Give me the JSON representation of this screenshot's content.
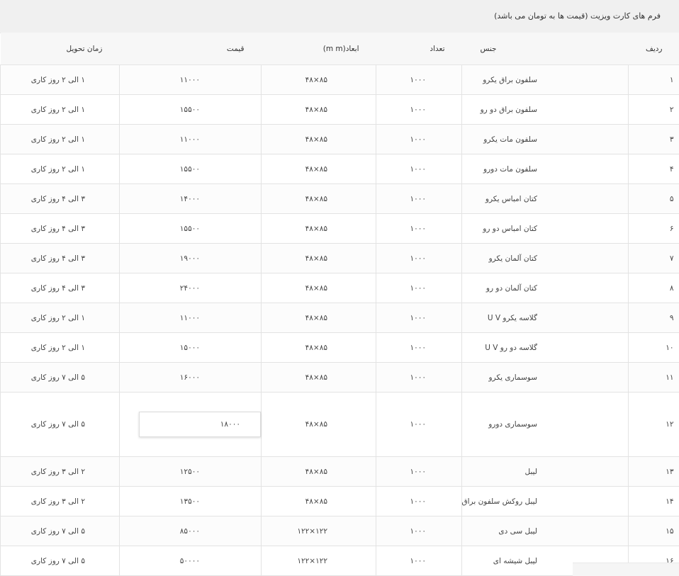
{
  "caption": "فرم های کارت ویزیت (قیمت ها به تومان می باشد)",
  "headers": {
    "row": "ردیف",
    "material": "جنس",
    "quantity": "تعداد",
    "dimensions": "ابعاد(m m)",
    "price": "قیمت",
    "delivery": "زمان تحویل"
  },
  "rows": [
    {
      "num": "۱",
      "material": "سلفون براق یکرو",
      "qty": "۱۰۰۰",
      "dim": "۸۵×۴۸",
      "price": "۱۱۰۰۰",
      "time": "۱ الی ۲ روز کاری"
    },
    {
      "num": "۲",
      "material": "سلفون براق دو رو",
      "qty": "۱۰۰۰",
      "dim": "۸۵×۴۸",
      "price": "۱۵۵۰۰",
      "time": "۱ الی ۲ روز کاری"
    },
    {
      "num": "۳",
      "material": "سلفون مات یکرو",
      "qty": "۱۰۰۰",
      "dim": "۸۵×۴۸",
      "price": "۱۱۰۰۰",
      "time": "۱ الی ۲ روز کاری"
    },
    {
      "num": "۴",
      "material": "سلفون مات دورو",
      "qty": "۱۰۰۰",
      "dim": "۸۵×۴۸",
      "price": "۱۵۵۰۰",
      "time": "۱ الی ۲ روز کاری"
    },
    {
      "num": "۵",
      "material": "کتان امباس یکرو",
      "qty": "۱۰۰۰",
      "dim": "۸۵×۴۸",
      "price": "۱۴۰۰۰",
      "time": "۳ الی ۴ روز کاری"
    },
    {
      "num": "۶",
      "material": "کتان امباس دو رو",
      "qty": "۱۰۰۰",
      "dim": "۸۵×۴۸",
      "price": "۱۵۵۰۰",
      "time": "۳ الی ۴ روز کاری"
    },
    {
      "num": "۷",
      "material": "کتان آلمان یکرو",
      "qty": "۱۰۰۰",
      "dim": "۸۵×۴۸",
      "price": "۱۹۰۰۰",
      "time": "۳ الی ۴ روز کاری"
    },
    {
      "num": "۸",
      "material": "کتان آلمان دو رو",
      "qty": "۱۰۰۰",
      "dim": "۸۵×۴۸",
      "price": "۲۴۰۰۰",
      "time": "۳ الی ۴ روز کاری"
    },
    {
      "num": "۹",
      "material": "گلاسه یکرو U V",
      "qty": "۱۰۰۰",
      "dim": "۸۵×۴۸",
      "price": "۱۱۰۰۰",
      "time": "۱ الی ۲ روز کاری"
    },
    {
      "num": "۱۰",
      "material": "گلاسه دو رو U V",
      "qty": "۱۰۰۰",
      "dim": "۸۵×۴۸",
      "price": "۱۵۰۰۰",
      "time": "۱ الی ۲ روز کاری"
    },
    {
      "num": "۱۱",
      "material": "سوسماری یکرو",
      "qty": "۱۰۰۰",
      "dim": "۸۵×۴۸",
      "price": "۱۶۰۰۰",
      "time": "۵ الی ۷ روز کاری"
    },
    {
      "num": "۱۲",
      "material": "سوسماری دورو",
      "qty": "۱۰۰۰",
      "dim": "۸۵×۴۸",
      "price": "۱۸۰۰۰",
      "time": "۵ الی ۷ روز کاری"
    },
    {
      "num": "۱۳",
      "material": "لیبل",
      "qty": "۱۰۰۰",
      "dim": "۸۵×۴۸",
      "price": "۱۲۵۰۰",
      "time": "۲ الی ۳ روز کاری"
    },
    {
      "num": "۱۴",
      "material": "لیبل روکش سلفون براق",
      "qty": "۱۰۰۰",
      "dim": "۸۵×۴۸",
      "price": "۱۳۵۰۰",
      "time": "۲ الی ۳ روز کاری"
    },
    {
      "num": "۱۵",
      "material": "لیبل سی دی",
      "qty": "۱۰۰۰",
      "dim": "۱۲۲×۱۲۲",
      "price": "۸۵۰۰۰",
      "time": "۵ الی ۷ روز کاری"
    },
    {
      "num": "۱۶",
      "material": "لیبل شیشه ای",
      "qty": "۱۰۰۰",
      "dim": "۱۲۲×۱۲۲",
      "price": "۵۰۰۰۰",
      "time": "۵ الی ۷ روز کاری"
    }
  ]
}
